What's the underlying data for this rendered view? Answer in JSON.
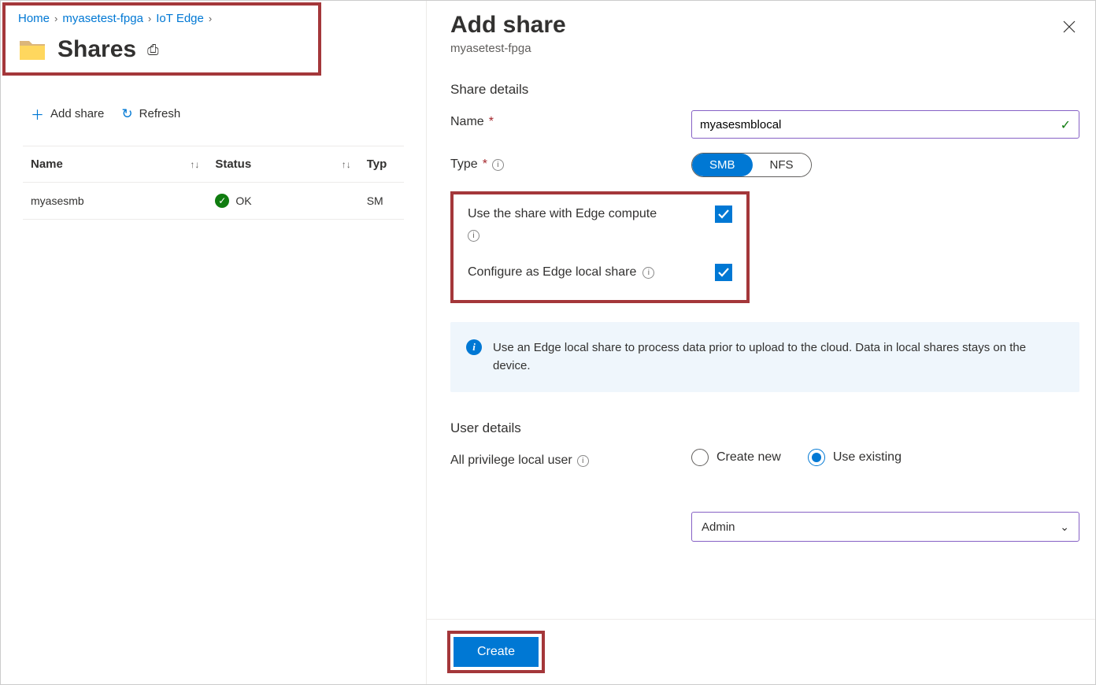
{
  "breadcrumb": {
    "home": "Home",
    "resource": "myasetest-fpga",
    "section": "IoT Edge"
  },
  "page_title": "Shares",
  "toolbar": {
    "add": "Add share",
    "refresh": "Refresh"
  },
  "table": {
    "headers": {
      "name": "Name",
      "status": "Status",
      "type": "Typ"
    },
    "rows": [
      {
        "name": "myasesmb",
        "status": "OK",
        "type": "SM"
      }
    ]
  },
  "panel": {
    "title": "Add share",
    "subtitle": "myasetest-fpga",
    "share_details": "Share details",
    "name_label": "Name",
    "name_value": "myasesmblocal",
    "type_label": "Type",
    "type_opts": {
      "smb": "SMB",
      "nfs": "NFS"
    },
    "edge_compute_label": "Use the share with Edge compute",
    "edge_local_label": "Configure as Edge local share",
    "banner": "Use an Edge local share to process data prior to upload to the cloud. Data in local shares stays on the device.",
    "user_details": "User details",
    "user_label": "All privilege local user",
    "create_new": "Create new",
    "use_existing": "Use existing",
    "user_selected": "Admin",
    "create": "Create"
  }
}
